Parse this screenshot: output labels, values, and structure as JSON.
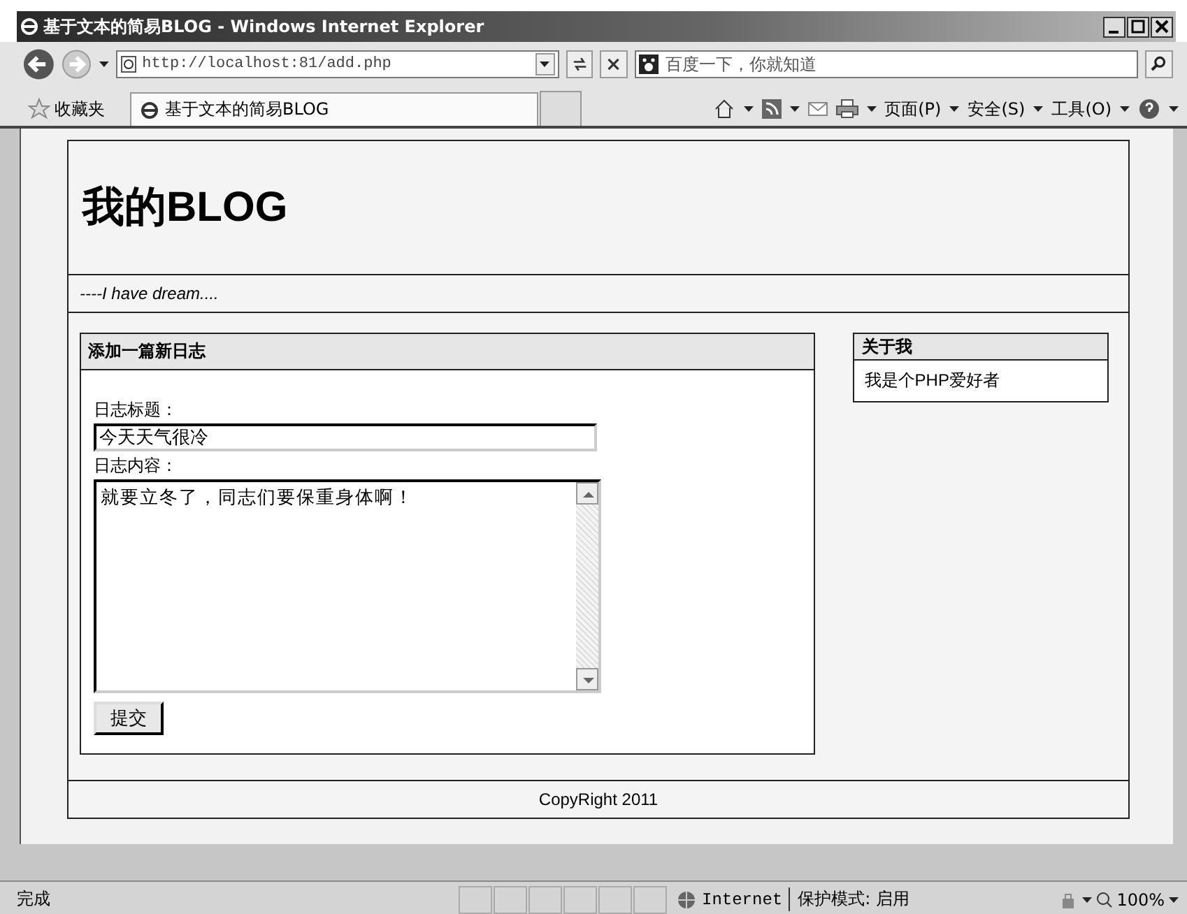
{
  "window": {
    "title": "基于文本的简易BLOG - Windows Internet Explorer"
  },
  "address_bar": {
    "url": "http://localhost:81/add.php"
  },
  "search": {
    "placeholder": "百度一下，你就知道"
  },
  "favorites": {
    "label": "收藏夹"
  },
  "tabs": [
    {
      "label": "基于文本的简易BLOG",
      "selected": true
    }
  ],
  "command_bar": [
    "页面(P)",
    "安全(S)",
    "工具(O)"
  ],
  "page": {
    "site_title": "我的BLOG",
    "tagline": "----I have dream....",
    "form": {
      "heading": "添加一篇新日志",
      "title_label": "日志标题：",
      "title_value": "今天天气很冷",
      "content_label": "日志内容：",
      "content_value": "就要立冬了，同志们要保重身体啊！",
      "submit": "提交"
    },
    "about": {
      "heading": "关于我",
      "text": "我是个PHP爱好者"
    },
    "footer": "CopyRight 2011"
  },
  "status_bar": {
    "text": "完成",
    "zone": "Internet",
    "protected_mode": "保护模式: 启用",
    "zoom": "100%"
  }
}
